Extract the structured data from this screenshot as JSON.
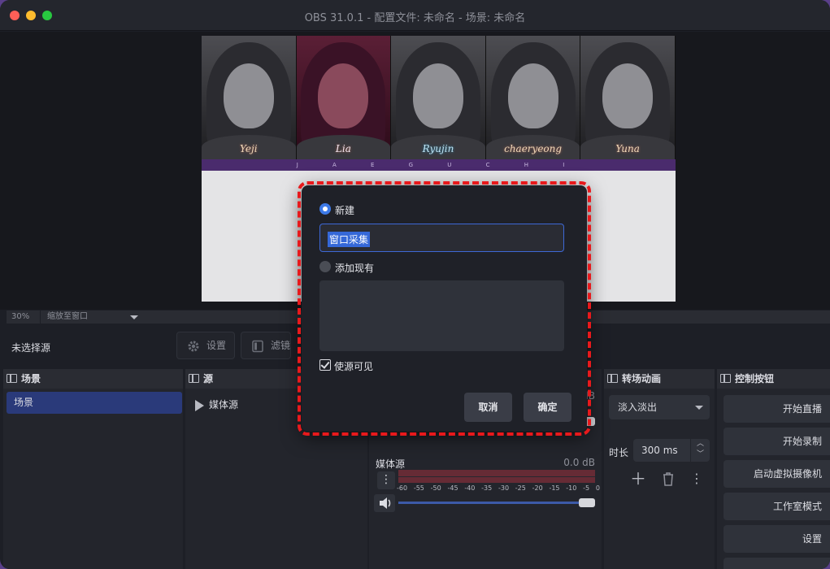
{
  "window": {
    "title": "OBS 31.0.1 - 配置文件: 未命名 - 场景: 未命名"
  },
  "preview": {
    "members": [
      "Yeji",
      "Lia",
      "Ryujin",
      "chaeryeong",
      "Yuna"
    ],
    "banner_text": "J A E G U C H I"
  },
  "zoom": {
    "percent": "30%",
    "mode": "缩放至窗口"
  },
  "source_toolbar": {
    "no_source": "未选择源",
    "settings_label": "设置",
    "filters_label": "滤镜"
  },
  "docks": {
    "scenes": {
      "title": "场景",
      "items": [
        "场景"
      ]
    },
    "sources": {
      "title": "源",
      "items": [
        "媒体源"
      ]
    },
    "mixer": {
      "rows": [
        {
          "name": "媒体源",
          "db": "0.0 dB"
        }
      ],
      "scale": [
        "-60",
        "-55",
        "-50",
        "-45",
        "-40",
        "-35",
        "-30",
        "-25",
        "-20",
        "-15",
        "-10",
        "-5",
        "0"
      ],
      "hidden_row_db": "dB"
    },
    "transitions": {
      "title": "转场动画",
      "selected": "淡入淡出",
      "duration_label": "时长",
      "duration_value": "300 ms"
    },
    "controls": {
      "title": "控制按钮",
      "buttons": [
        "开始直播",
        "开始录制",
        "启动虚拟摄像机",
        "工作室模式",
        "设置"
      ]
    }
  },
  "dialog": {
    "new_label": "新建",
    "name_value": "窗口采集",
    "existing_label": "添加现有",
    "visible_label": "使源可见",
    "cancel_label": "取消",
    "ok_label": "确定",
    "highlight_color": "#e8191c"
  },
  "colors": {
    "accent": "#3d7ae8",
    "selection": "#2a3a7a",
    "meter_red": "#b83440"
  }
}
